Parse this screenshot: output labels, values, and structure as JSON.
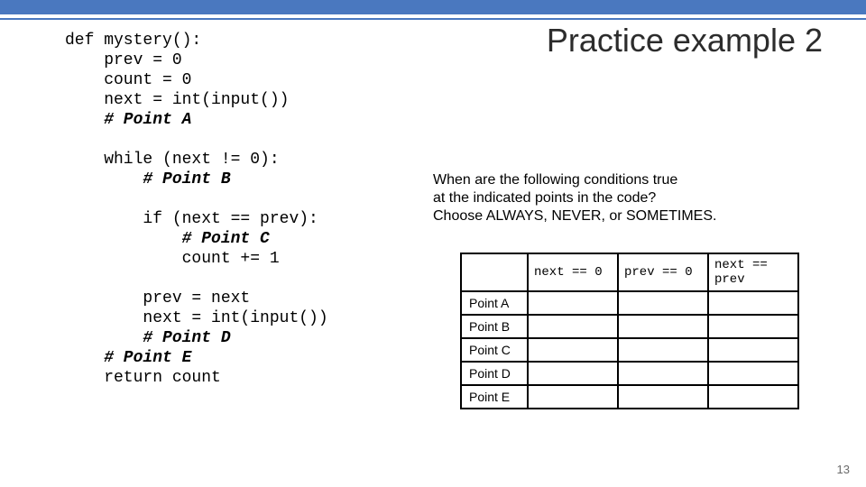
{
  "title": "Practice example 2",
  "code": {
    "l1": "def mystery():",
    "l2": "    prev = 0",
    "l3": "    count = 0",
    "l4": "    next = int(input())",
    "l5": "    # Point A",
    "l6": "",
    "l7": "    while (next != 0):",
    "l8": "        # Point B",
    "l9": "",
    "l10": "        if (next == prev):",
    "l11": "            # Point C",
    "l12": "            count += 1",
    "l13": "",
    "l14": "        prev = next",
    "l15": "        next = int(input())",
    "l16": "        # Point D",
    "l17": "    # Point E",
    "l18": "    return count"
  },
  "question": {
    "line1": "When are the following conditions true",
    "line2": "at the indicated points in the code?",
    "line3": "Choose ALWAYS, NEVER, or SOMETIMES."
  },
  "table": {
    "col1": "next == 0",
    "col2": "prev == 0",
    "col3": "next == prev",
    "row1": "Point A",
    "row2": "Point B",
    "row3": "Point C",
    "row4": "Point D",
    "row5": "Point E"
  },
  "page_number": "13",
  "chart_data": {
    "type": "table",
    "columns": [
      "next == 0",
      "prev == 0",
      "next == prev"
    ],
    "rows": [
      "Point A",
      "Point B",
      "Point C",
      "Point D",
      "Point E"
    ],
    "cells": [
      [
        "",
        "",
        ""
      ],
      [
        "",
        "",
        ""
      ],
      [
        "",
        "",
        ""
      ],
      [
        "",
        "",
        ""
      ],
      [
        "",
        "",
        ""
      ]
    ],
    "title": "Practice example 2"
  }
}
